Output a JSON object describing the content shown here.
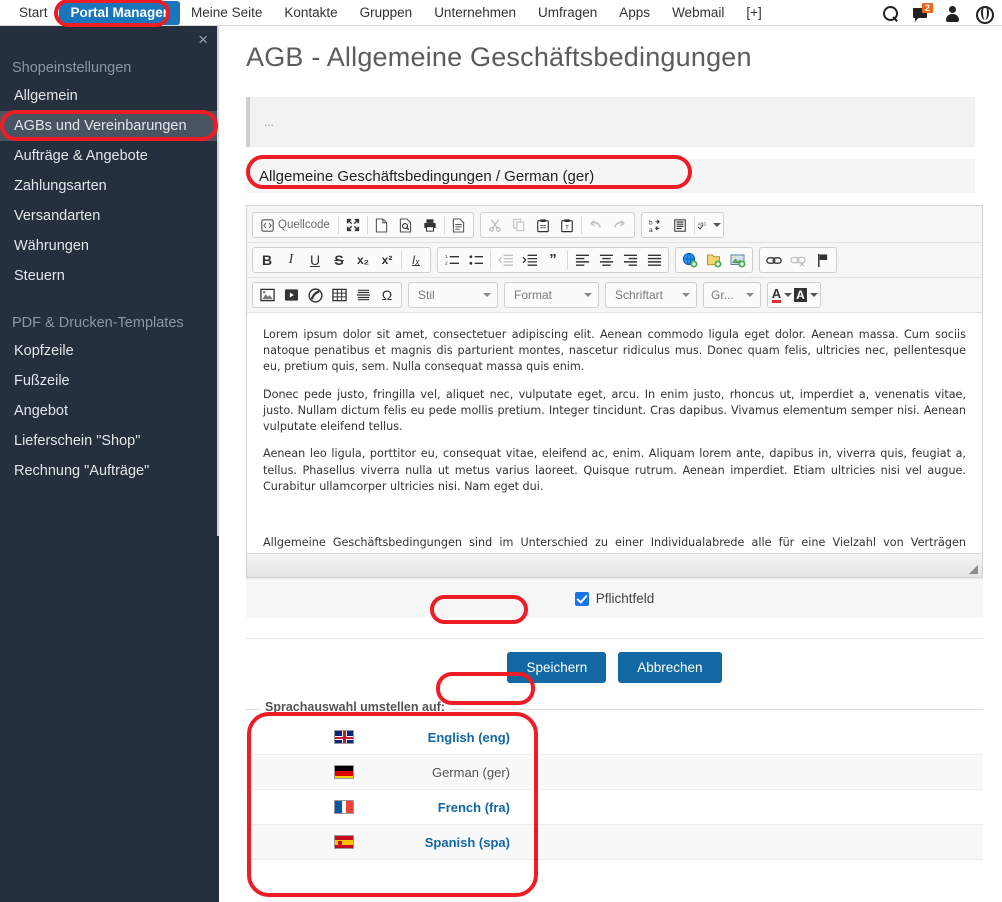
{
  "topnav": {
    "items": [
      {
        "label": "Start",
        "active": false
      },
      {
        "label": "Portal Manager",
        "active": true
      },
      {
        "label": "Meine Seite",
        "active": false
      },
      {
        "label": "Kontakte",
        "active": false
      },
      {
        "label": "Gruppen",
        "active": false
      },
      {
        "label": "Unternehmen",
        "active": false
      },
      {
        "label": "Umfragen",
        "active": false
      },
      {
        "label": "Apps",
        "active": false
      },
      {
        "label": "Webmail",
        "active": false
      },
      {
        "label": "[+]",
        "active": false
      }
    ],
    "icons": [
      "search-icon",
      "messages-icon",
      "user-icon",
      "globe-icon"
    ],
    "message_badge": "2",
    "active_color": "#1b75bb"
  },
  "sidebar": {
    "close_label": "×",
    "groups": [
      {
        "title": "Shopeinstellungen",
        "items": [
          {
            "label": "Allgemein",
            "selected": false
          },
          {
            "label": "AGBs und Vereinbarungen",
            "selected": true
          },
          {
            "label": "Aufträge & Angebote",
            "selected": false
          },
          {
            "label": "Zahlungsarten",
            "selected": false
          },
          {
            "label": "Versandarten",
            "selected": false
          },
          {
            "label": "Währungen",
            "selected": false
          },
          {
            "label": "Steuern",
            "selected": false
          }
        ]
      },
      {
        "title": "PDF & Drucken-Templates",
        "items": [
          {
            "label": "Kopfzeile",
            "selected": false
          },
          {
            "label": "Fußzeile",
            "selected": false
          },
          {
            "label": "Angebot",
            "selected": false
          },
          {
            "label": "Lieferschein \"Shop\"",
            "selected": false
          },
          {
            "label": "Rechnung \"Aufträge\"",
            "selected": false
          }
        ]
      }
    ],
    "background": "#262f3d"
  },
  "main": {
    "page_title": "AGB - Allgemeine Geschäftsbedingungen",
    "info_panel_text": "...",
    "section_header": "Allgemeine Geschäftsbedingungen / German (ger)"
  },
  "editor": {
    "toolbar_row1": [
      {
        "name": "source-code-button",
        "label": "Quellcode",
        "icon": "code-icon"
      },
      {
        "name": "maximize-button",
        "label": "",
        "icon": "maximize-icon"
      },
      {
        "name": "new-page-button",
        "label": "",
        "icon": "new-page-icon"
      },
      {
        "name": "preview-button",
        "label": "",
        "icon": "preview-icon"
      },
      {
        "name": "print-button",
        "label": "",
        "icon": "print-icon"
      },
      {
        "name": "templates-button",
        "label": "",
        "icon": "templates-icon"
      },
      {
        "name": "cut-button",
        "label": "",
        "icon": "scissors-icon"
      },
      {
        "name": "copy-button",
        "label": "",
        "icon": "copy-icon"
      },
      {
        "name": "paste-button",
        "label": "",
        "icon": "paste-icon"
      },
      {
        "name": "paste-text-button",
        "label": "",
        "icon": "paste-text-icon"
      },
      {
        "name": "undo-button",
        "label": "",
        "icon": "undo-arrow-icon"
      },
      {
        "name": "redo-button",
        "label": "",
        "icon": "redo-arrow-icon"
      },
      {
        "name": "find-replace-button",
        "label": "",
        "icon": "find-replace-icon"
      },
      {
        "name": "select-all-button",
        "label": "",
        "icon": "select-all-icon"
      },
      {
        "name": "spellcheck-button",
        "label": "",
        "icon": "spellcheck-abc-icon"
      }
    ],
    "toolbar_row2": [
      {
        "name": "bold-button",
        "label": "B",
        "icon": "bold-icon"
      },
      {
        "name": "italic-button",
        "label": "I",
        "icon": "italic-icon"
      },
      {
        "name": "underline-button",
        "label": "U",
        "icon": "underline-icon"
      },
      {
        "name": "strikethrough-button",
        "label": "S",
        "icon": "strikethrough-icon"
      },
      {
        "name": "subscript-button",
        "label": "x₂",
        "icon": "subscript-icon"
      },
      {
        "name": "superscript-button",
        "label": "x²",
        "icon": "superscript-icon"
      },
      {
        "name": "remove-format-button",
        "label": "Iₓ",
        "icon": "remove-format-icon"
      },
      {
        "name": "numbered-list-button",
        "label": "",
        "icon": "numbered-list-icon"
      },
      {
        "name": "bulleted-list-button",
        "label": "",
        "icon": "bulleted-list-icon"
      },
      {
        "name": "outdent-button",
        "label": "",
        "icon": "outdent-icon"
      },
      {
        "name": "indent-button",
        "label": "",
        "icon": "indent-icon"
      },
      {
        "name": "blockquote-button",
        "label": "”",
        "icon": "blockquote-icon"
      },
      {
        "name": "align-left-button",
        "label": "",
        "icon": "align-left-icon"
      },
      {
        "name": "align-center-button",
        "label": "",
        "icon": "align-center-icon"
      },
      {
        "name": "align-right-button",
        "label": "",
        "icon": "align-right-icon"
      },
      {
        "name": "align-justify-button",
        "label": "",
        "icon": "align-justify-icon"
      },
      {
        "name": "insert-link-globe-button",
        "label": "",
        "icon": "globe-add-icon"
      },
      {
        "name": "insert-file-button",
        "label": "",
        "icon": "folder-add-icon"
      },
      {
        "name": "insert-image-button",
        "label": "",
        "icon": "image-add-icon"
      },
      {
        "name": "link-button",
        "label": "",
        "icon": "link-icon"
      },
      {
        "name": "unlink-button",
        "label": "",
        "icon": "unlink-icon"
      },
      {
        "name": "anchor-button",
        "label": "",
        "icon": "flag-anchor-icon"
      }
    ],
    "toolbar_row3": [
      {
        "name": "image-button",
        "label": "",
        "icon": "picture-icon"
      },
      {
        "name": "video-button",
        "label": "",
        "icon": "video-icon"
      },
      {
        "name": "flash-button",
        "label": "",
        "icon": "flash-icon"
      },
      {
        "name": "table-button",
        "label": "",
        "icon": "table-icon"
      },
      {
        "name": "horizontal-rule-button",
        "label": "",
        "icon": "horizontal-rule-icon"
      },
      {
        "name": "special-char-button",
        "label": "Ω",
        "icon": "omega-icon"
      }
    ],
    "selects": [
      {
        "name": "style-select",
        "label": "Stil"
      },
      {
        "name": "format-select",
        "label": "Format"
      },
      {
        "name": "font-select",
        "label": "Schriftart"
      },
      {
        "name": "size-select",
        "label": "Gr..."
      }
    ],
    "color_buttons": [
      {
        "name": "text-color-button",
        "label": "A",
        "icon": "text-color-icon"
      },
      {
        "name": "background-color-button",
        "label": "A",
        "icon": "bg-color-icon"
      }
    ],
    "content": [
      "Lorem ipsum dolor sit amet, consectetuer adipiscing elit. Aenean commodo ligula eget dolor. Aenean massa. Cum sociis natoque penatibus et magnis dis parturient montes, nascetur ridiculus mus. Donec quam felis, ultricies nec, pellentesque eu, pretium quis, sem. Nulla consequat massa quis enim.",
      "Donec pede justo, fringilla vel, aliquet nec, vulputate eget, arcu. In enim justo, rhoncus ut, imperdiet a, venenatis vitae, justo. Nullam dictum felis eu pede mollis pretium. Integer tincidunt. Cras dapibus. Vivamus elementum semper nisi. Aenean vulputate eleifend tellus.",
      "Aenean leo ligula, porttitor eu, consequat vitae, eleifend ac, enim. Aliquam lorem ante, dapibus in, viverra quis, feugiat a, tellus. Phasellus viverra nulla ut metus varius laoreet. Quisque rutrum. Aenean imperdiet. Etiam ultricies nisi vel augue. Curabitur ullamcorper ultricies nisi. Nam eget dui.",
      "Allgemeine Geschäftsbedingungen sind im Unterschied zu einer Individualabrede alle für eine Vielzahl von Verträgen vorformulierten Vertragsbedingungen, die eine Vertragspartei der anderen Vertragspartei bei Abschluss eines Vertrages stellt."
    ]
  },
  "form": {
    "required_checkbox_label": "Pflichtfeld",
    "required_checked": true,
    "save_button": "Speichern",
    "cancel_button": "Abbrechen",
    "button_color": "#1268a3"
  },
  "language": {
    "legend": "Sprachauswahl umstellen auf:",
    "rows": [
      {
        "flag": "flag-eng",
        "name": "English (eng)",
        "current": false
      },
      {
        "flag": "flag-ger",
        "name": "German (ger)",
        "current": true
      },
      {
        "flag": "flag-fra",
        "name": "French (fra)",
        "current": false
      },
      {
        "flag": "flag-spa",
        "name": "Spanish (spa)",
        "current": false
      }
    ],
    "link_color": "#1268a3"
  },
  "annotations": {
    "highlight_color": "#ee1c25",
    "rings": [
      "portal-manager-nav-item",
      "agbs-sidebar-item",
      "section-header",
      "required-checkbox",
      "save-button",
      "language-selection-box"
    ]
  }
}
